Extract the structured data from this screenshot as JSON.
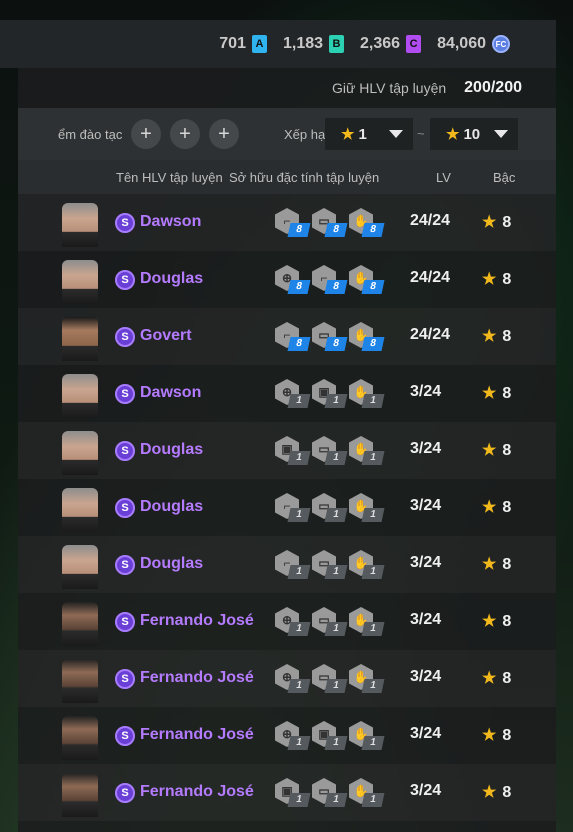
{
  "currencies": [
    {
      "value": "701",
      "badge": "A",
      "color": "#2fb4f0"
    },
    {
      "value": "1,183",
      "badge": "B",
      "color": "#2bd1b2"
    },
    {
      "value": "2,366",
      "badge": "C",
      "color": "#b04cf0"
    },
    {
      "value": "84,060",
      "badge": "FC",
      "color": "#5b7ee0"
    }
  ],
  "holding": {
    "label": "Giữ HLV tập luyện",
    "value": "200/200"
  },
  "filter": {
    "label": "ểm đào tạc",
    "rank_label": "Xếp hạ",
    "separator": "~",
    "rank_from": "1",
    "rank_to": "10",
    "plus_symbol": "+"
  },
  "columns": {
    "name": "Tên HLV tập luyện",
    "traits": "Sở hữu đặc tính tập luyện",
    "lv": "LV",
    "grade": "Bậc"
  },
  "coaches": [
    {
      "badge": "S",
      "name": "Dawson",
      "lv": "24/24",
      "grade": "8",
      "face": "light",
      "traits": [
        {
          "icon": "boot-icon",
          "level": "8",
          "tier": "blue"
        },
        {
          "icon": "shield-icon",
          "level": "8",
          "tier": "blue"
        },
        {
          "icon": "hand-icon",
          "level": "8",
          "tier": "blue"
        }
      ]
    },
    {
      "badge": "S",
      "name": "Douglas",
      "lv": "24/24",
      "grade": "8",
      "face": "light",
      "traits": [
        {
          "icon": "target-icon",
          "level": "8",
          "tier": "blue"
        },
        {
          "icon": "boot-icon",
          "level": "8",
          "tier": "blue"
        },
        {
          "icon": "hand-icon",
          "level": "8",
          "tier": "blue"
        }
      ]
    },
    {
      "badge": "S",
      "name": "Govert",
      "lv": "24/24",
      "grade": "8",
      "face": "dark",
      "traits": [
        {
          "icon": "boot-icon",
          "level": "8",
          "tier": "blue"
        },
        {
          "icon": "shield-icon",
          "level": "8",
          "tier": "blue"
        },
        {
          "icon": "hand-icon",
          "level": "8",
          "tier": "blue"
        }
      ]
    },
    {
      "badge": "S",
      "name": "Dawson",
      "lv": "3/24",
      "grade": "8",
      "face": "light",
      "traits": [
        {
          "icon": "target-icon",
          "level": "1",
          "tier": "grey"
        },
        {
          "icon": "card-icon",
          "level": "1",
          "tier": "grey"
        },
        {
          "icon": "hand-icon",
          "level": "1",
          "tier": "grey"
        }
      ]
    },
    {
      "badge": "S",
      "name": "Douglas",
      "lv": "3/24",
      "grade": "8",
      "face": "light",
      "traits": [
        {
          "icon": "card-icon",
          "level": "1",
          "tier": "grey"
        },
        {
          "icon": "shield-icon",
          "level": "1",
          "tier": "grey"
        },
        {
          "icon": "hand-icon",
          "level": "1",
          "tier": "grey"
        }
      ]
    },
    {
      "badge": "S",
      "name": "Douglas",
      "lv": "3/24",
      "grade": "8",
      "face": "light",
      "traits": [
        {
          "icon": "boot-icon",
          "level": "1",
          "tier": "grey"
        },
        {
          "icon": "shield-icon",
          "level": "1",
          "tier": "grey"
        },
        {
          "icon": "hand-icon",
          "level": "1",
          "tier": "grey"
        }
      ]
    },
    {
      "badge": "S",
      "name": "Douglas",
      "lv": "3/24",
      "grade": "8",
      "face": "light",
      "traits": [
        {
          "icon": "boot-icon",
          "level": "1",
          "tier": "grey"
        },
        {
          "icon": "shield-icon",
          "level": "1",
          "tier": "grey"
        },
        {
          "icon": "hand-icon",
          "level": "1",
          "tier": "grey"
        }
      ]
    },
    {
      "badge": "S",
      "name": "Fernando José",
      "lv": "3/24",
      "grade": "8",
      "face": "beard",
      "traits": [
        {
          "icon": "target-icon",
          "level": "1",
          "tier": "grey"
        },
        {
          "icon": "shield-icon",
          "level": "1",
          "tier": "grey"
        },
        {
          "icon": "hand-icon",
          "level": "1",
          "tier": "grey"
        }
      ]
    },
    {
      "badge": "S",
      "name": "Fernando José",
      "lv": "3/24",
      "grade": "8",
      "face": "beard",
      "traits": [
        {
          "icon": "target-icon",
          "level": "1",
          "tier": "grey"
        },
        {
          "icon": "shield-icon",
          "level": "1",
          "tier": "grey"
        },
        {
          "icon": "hand-icon",
          "level": "1",
          "tier": "grey"
        }
      ]
    },
    {
      "badge": "S",
      "name": "Fernando José",
      "lv": "3/24",
      "grade": "8",
      "face": "beard",
      "traits": [
        {
          "icon": "target-icon",
          "level": "1",
          "tier": "grey"
        },
        {
          "icon": "card-icon",
          "level": "1",
          "tier": "grey"
        },
        {
          "icon": "hand-icon",
          "level": "1",
          "tier": "grey"
        }
      ]
    },
    {
      "badge": "S",
      "name": "Fernando José",
      "lv": "3/24",
      "grade": "8",
      "face": "beard",
      "traits": [
        {
          "icon": "card-icon",
          "level": "1",
          "tier": "grey"
        },
        {
          "icon": "shield-icon",
          "level": "1",
          "tier": "grey"
        },
        {
          "icon": "hand-icon",
          "level": "1",
          "tier": "grey"
        }
      ]
    }
  ]
}
